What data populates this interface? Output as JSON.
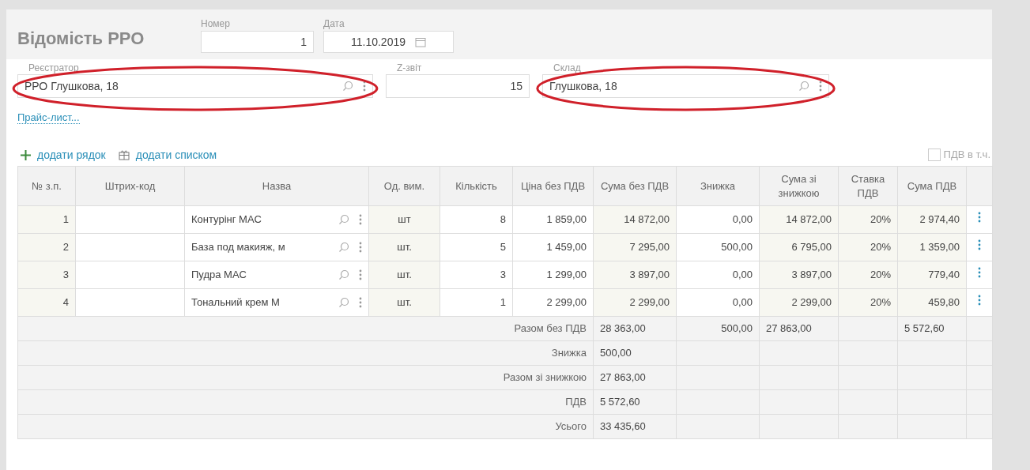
{
  "title": "Відомість РРО",
  "header_fields": [
    {
      "label": "Номер",
      "value": "1",
      "kind": "number"
    },
    {
      "label": "Дата",
      "value": "11.10.2019",
      "kind": "date"
    }
  ],
  "fields": [
    {
      "label": "Реєстратор",
      "value": "РРО Глушкова, 18",
      "kind": "lookup",
      "circled": true
    },
    {
      "label": "Z-звіт",
      "value": "15",
      "kind": "number",
      "circled": false
    },
    {
      "label": "Склад",
      "value": "Глушкова, 18",
      "kind": "lookup",
      "circled": true
    }
  ],
  "price_list_link": "Прайс-лист...",
  "toolbar": [
    {
      "label": "додати рядок",
      "kind": "add"
    },
    {
      "label": "додати списком",
      "kind": "list"
    }
  ],
  "vat_included": {
    "label": "ПДВ в т.ч.",
    "checked": false
  },
  "table": {
    "columns": [
      "№ з.п.",
      "Штрих-код",
      "Назва",
      "Од. вим.",
      "Кількість",
      "Ціна без ПДВ",
      "Сума без ПДВ",
      "Знижка",
      "Сума зі знижкою",
      "Ставка ПДВ",
      "Сума ПДВ"
    ],
    "rows": [
      [
        "1",
        "",
        "Контурінг MAC",
        "шт",
        "8",
        "1 859,00",
        "14 872,00",
        "0,00",
        "14 872,00",
        "20%",
        "2 974,40"
      ],
      [
        "2",
        "",
        "База под макияж, м",
        "шт.",
        "5",
        "1 459,00",
        "7 295,00",
        "500,00",
        "6 795,00",
        "20%",
        "1 359,00"
      ],
      [
        "3",
        "",
        "Пудра MAC",
        "шт.",
        "3",
        "1 299,00",
        "3 897,00",
        "0,00",
        "3 897,00",
        "20%",
        "779,40"
      ],
      [
        "4",
        "",
        "Тональний крем М",
        "шт.",
        "1",
        "2 299,00",
        "2 299,00",
        "0,00",
        "2 299,00",
        "20%",
        "459,80"
      ]
    ],
    "totals": [
      {
        "label": "Разом без ПДВ",
        "value": "28 363,00",
        "discount": "500,00",
        "with_discount": "27 863,00",
        "vat": "5 572,60"
      },
      {
        "label": "Знижка",
        "value": "500,00"
      },
      {
        "label": "Разом зі знижкою",
        "value": "27 863,00"
      },
      {
        "label": "ПДВ",
        "value": "5 572,60"
      },
      {
        "label": "Усього",
        "value": "33 435,60"
      }
    ]
  }
}
